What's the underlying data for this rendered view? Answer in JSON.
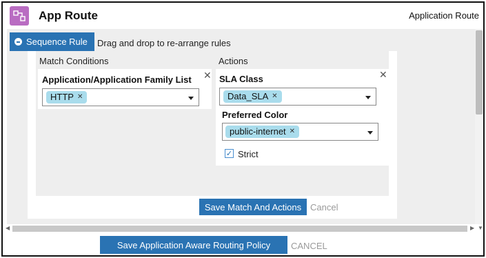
{
  "header": {
    "icon": "app-route-icon",
    "title": "App Route",
    "right_label": "Application Route",
    "accent_color": "#b96cc2"
  },
  "toolbar": {
    "sequence_rule_label": "Sequence Rule",
    "hint": "Drag and drop to re-arrange rules"
  },
  "match": {
    "section_title": "Match Conditions",
    "field_label": "Application/Application Family List",
    "chips": [
      "HTTP"
    ]
  },
  "actions": {
    "section_title": "Actions",
    "sla_label": "SLA Class",
    "sla_chips": [
      "Data_SLA"
    ],
    "color_label": "Preferred Color",
    "color_chips": [
      "public-internet"
    ],
    "strict_label": "Strict",
    "strict_checked": true
  },
  "rule_buttons": {
    "save_label": "Save Match And Actions",
    "cancel_label": "Cancel"
  },
  "footer": {
    "save_policy_label": "Save Application Aware Routing Policy",
    "cancel_label": "CANCEL"
  },
  "colors": {
    "primary": "#2a73b3",
    "chip": "#a9dcec",
    "workspace": "#eeeeee"
  }
}
